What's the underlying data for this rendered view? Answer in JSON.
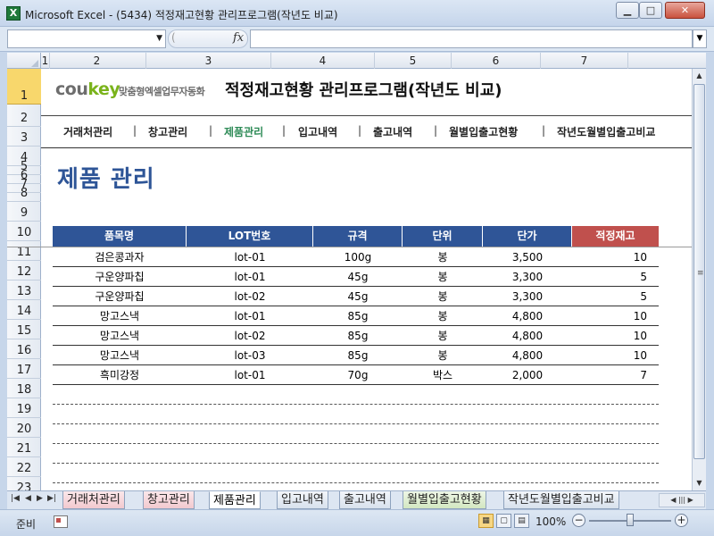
{
  "window": {
    "title": "Microsoft Excel - (5434) 적정재고현황 관리프로그램(작년도 비교)",
    "app_icon": "X"
  },
  "formula_bar": {
    "name_box": "",
    "fx_label": "fx",
    "formula": ""
  },
  "columns": [
    "1",
    "2",
    "3",
    "4",
    "5",
    "6",
    "7"
  ],
  "rows": [
    "1",
    "2",
    "3",
    "4",
    "5",
    "6",
    "7",
    "8",
    "9",
    "10",
    "11",
    "12",
    "13",
    "14",
    "15",
    "16",
    "17",
    "18",
    "19",
    "20",
    "21",
    "22",
    "23"
  ],
  "banner": {
    "logo_left": "cou",
    "logo_right": "key",
    "logo_sub": "맞춤형엑셀업무자동화",
    "title": "적정재고현황 관리프로그램(작년도 비교)"
  },
  "nav": {
    "items": [
      "거래처관리",
      "창고관리",
      "제품관리",
      "입고내역",
      "출고내역",
      "월별입출고현황",
      "작년도월별입출고비교"
    ],
    "separator": "|"
  },
  "page": {
    "heading": "제품 관리"
  },
  "table": {
    "headers": [
      "품목명",
      "LOT번호",
      "규격",
      "단위",
      "단가",
      "적정재고"
    ],
    "rows": [
      [
        "검은콩과자",
        "lot-01",
        "100g",
        "봉",
        "3,500",
        "10"
      ],
      [
        "구운양파칩",
        "lot-01",
        "45g",
        "봉",
        "3,300",
        "5"
      ],
      [
        "구운양파칩",
        "lot-02",
        "45g",
        "봉",
        "3,300",
        "5"
      ],
      [
        "망고스낵",
        "lot-01",
        "85g",
        "봉",
        "4,800",
        "10"
      ],
      [
        "망고스낵",
        "lot-02",
        "85g",
        "봉",
        "4,800",
        "10"
      ],
      [
        "망고스낵",
        "lot-03",
        "85g",
        "봉",
        "4,800",
        "10"
      ],
      [
        "흑미강정",
        "lot-01",
        "70g",
        "박스",
        "2,000",
        "7"
      ]
    ]
  },
  "sheet_tabs": [
    "거래처관리",
    "창고관리",
    "제품관리",
    "입고내역",
    "출고내역",
    "월별입출고현황",
    "작년도월별입출고비교"
  ],
  "status": {
    "ready": "준비",
    "zoom": "100%"
  },
  "colors": {
    "header_blue": "#2f5597",
    "header_red": "#c0504d",
    "active_nav": "#2e8b57",
    "heading_blue": "#2e5597",
    "logo_green": "#7ab31b"
  }
}
